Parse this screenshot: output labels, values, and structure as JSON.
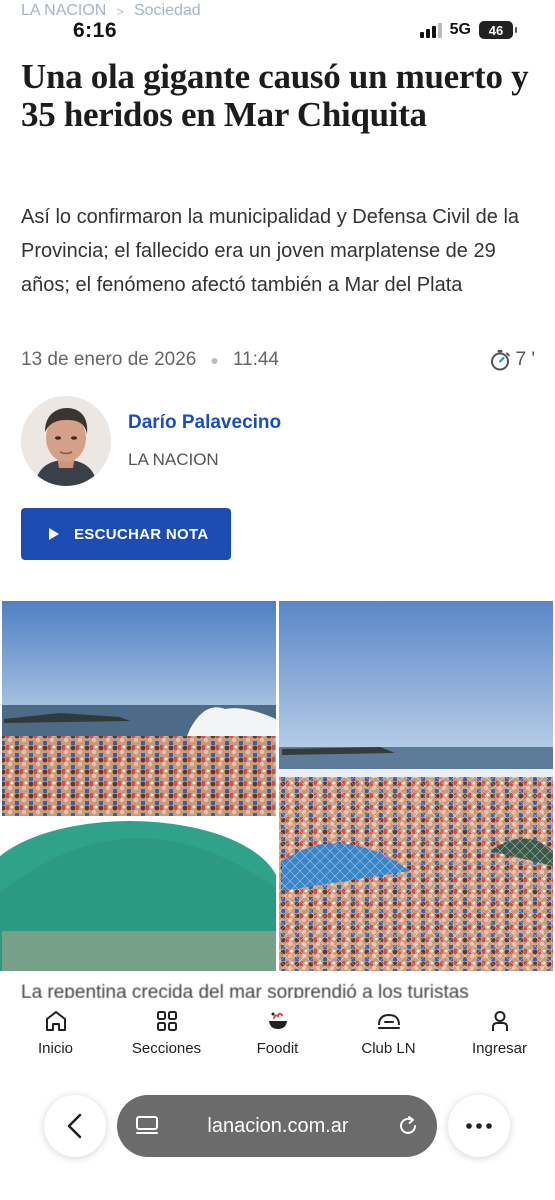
{
  "breadcrumb": {
    "site": "LA NACION",
    "separator": ">",
    "section": "Sociedad"
  },
  "status_bar": {
    "time": "6:16",
    "network": "5G",
    "battery": "46"
  },
  "article": {
    "headline": "Una ola gigante causó un muerto y 35 heridos en Mar Chiquita",
    "subtitle": "Así lo confirmaron la municipalidad y Defensa Civil de la Provincia; el fallecido era un joven marplatense de 29 años; el fenómeno afectó también a Mar del Plata",
    "date": "13 de enero de 2026",
    "time": "11:44",
    "reading_time": "7 '",
    "author_name": "Darío Palavecino",
    "author_org": "LA NACION",
    "listen_label": "ESCUCHAR NOTA",
    "partial_body": "La repentina crecida del mar sorprendió a los turistas"
  },
  "tabbar": {
    "items": [
      {
        "label": "Inicio",
        "icon": "home-icon"
      },
      {
        "label": "Secciones",
        "icon": "grid-icon"
      },
      {
        "label": "Foodit",
        "icon": "food-bowl-icon"
      },
      {
        "label": "Club LN",
        "icon": "club-icon"
      },
      {
        "label": "Ingresar",
        "icon": "person-icon"
      }
    ]
  },
  "browser": {
    "url": "lanacion.com.ar"
  },
  "colors": {
    "accent": "#1d4db3",
    "author_link": "#1a4fb8",
    "url_pill": "#6b6b6b"
  }
}
